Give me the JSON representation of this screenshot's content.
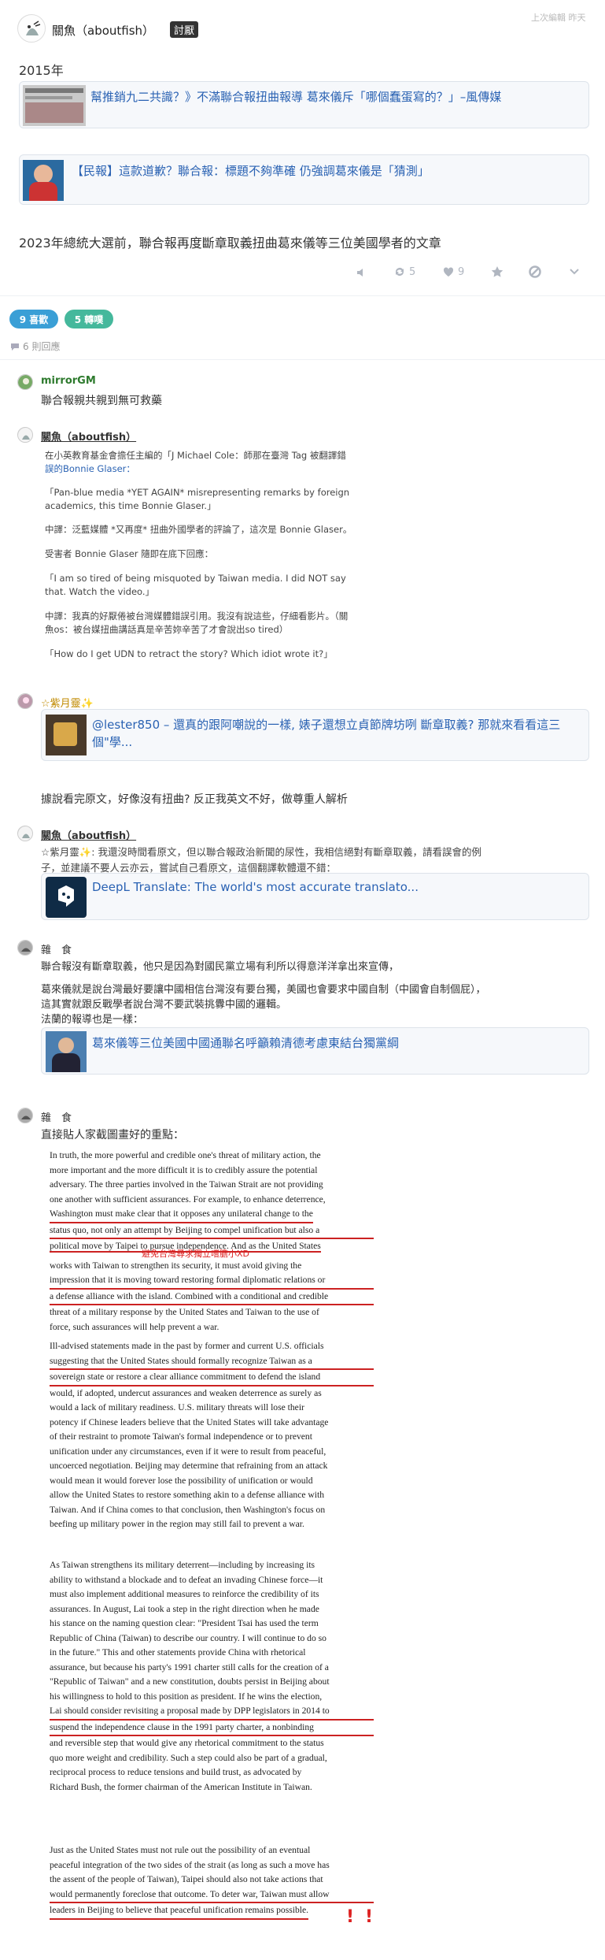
{
  "author": {
    "name": "關魚（aboutfish）",
    "badge": "討厭"
  },
  "edited": "上次編輯 昨天",
  "post": {
    "year": "2015年",
    "link1": "幫推銷九二共識？》不滿聯合報扭曲報導 葛來儀斥「哪個蠢蛋寫的？」–風傳媒",
    "link2": "【民報】這款道歉？聯合報：標題不夠準確 仍強調葛來儀是「猜測」",
    "text": "2023年總統大選前，聯合報再度斷章取義扭曲葛來儀等三位美國學者的文章",
    "actions": {
      "repost_count": "5",
      "like_count": "9"
    }
  },
  "tabs": {
    "likes": "9 喜歡",
    "reposts": "5 轉噗"
  },
  "replies_count": "6 則回應",
  "replies": [
    {
      "name": "mirrorGM",
      "text": "聯合報親共親到無可救藥"
    },
    {
      "name": "關魚（aboutfish）",
      "lines": [
        "在小英教育基金會擔任主編的「J Michael Cole：師那在臺灣 Tag 被翻譯錯",
        "誤的Bonnie Glaser：",
        "「Pan-blue media *YET AGAIN* misrepresenting remarks by foreign",
        "academics, this time Bonnie Glaser.」",
        "中譯：泛藍媒體 *又再度* 扭曲外國學者的評論了，這次是 Bonnie Glaser。",
        "受害者 Bonnie Glaser 隨即在底下回應：",
        "「I am so tired of being misquoted by Taiwan media. I did NOT say",
        "that. Watch the video.」",
        "中譯：我真的好厭倦被台灣媒體錯誤引用。我沒有說這些，仔細看影片。（關",
        "魚os：被台媒扭曲講話真是辛苦妳辛苦了才會說出so tired）",
        "「How do I get UDN to retract the story? Which idiot wrote it?」"
      ]
    },
    {
      "name": "☆紫月靈✨",
      "link": "@lester850 – 還真的跟阿嘲說的一樣, 婊子還想立貞節牌坊咧 斷章取義? 那就來看看這三個\"學...",
      "text": "據說看完原文，好像沒有扭曲? 反正我英文不好，做尊重人解析"
    },
    {
      "name": "關魚（aboutfish）",
      "line1": "☆紫月靈✨: 我還沒時間看原文，但以聯合報政治新聞的尿性，我相信絕對有斷章取義，請看誤會的例",
      "line2": "子，並建議不要人云亦云，嘗試自己看原文，這個翻譯軟體還不錯：",
      "link": "DeepL Translate: The world's most accurate translato..."
    },
    {
      "name": "雜　食",
      "lines": [
        "聯合報沒有斷章取義，他只是因為對國民黨立場有利所以得意洋洋拿出來宣傳，",
        "葛來儀就是說台灣最好要讓中國相信台灣沒有要台獨，美國也會要求中國自制（中國會自制個屁），",
        "這其實就跟反戰學者說台灣不要武裝挑釁中國的邏輯。",
        "法蘭的報導也是一樣："
      ],
      "link": "葛來儀等三位美國中國通聯名呼籲賴清德考慮東結台獨黨綱"
    },
    {
      "name": "雜　食",
      "text": "直接貼人家截圖畫好的重點："
    }
  ],
  "paper": {
    "handwritten_note": "避免台灣尋求獨立嚐膽小XD",
    "p1": [
      "In truth, the more powerful and credible one's threat of military action, the",
      "more important and the more difficult it is to credibly assure the potential",
      "adversary. The three parties involved in the Taiwan Strait are not providing",
      "one another with sufficient assurances. For example, to enhance deterrence,",
      "Washington must make clear that it opposes any unilateral change to the",
      "status quo, not only an attempt by Beijing to compel unification but also a",
      "political move by Taipei to pursue independence. And as the United States",
      "works with Taiwan to strengthen its security, it must avoid giving the",
      "impression that it is moving toward restoring formal diplomatic relations or",
      "a defense alliance with the island. Combined with a conditional and credible",
      "threat of a military response by the United States and Taiwan to the use of",
      "force, such assurances will help prevent a war."
    ],
    "p2": [
      "Ill-advised statements made in the past by former and current U.S. officials",
      "suggesting that the United States should formally recognize Taiwan as a",
      "sovereign state or restore a clear alliance commitment to defend the island",
      "would, if adopted, undercut assurances and weaken deterrence as surely as",
      "would a lack of military readiness. U.S. military threats will lose their",
      "potency if Chinese leaders believe that the United States will take advantage",
      "of their restraint to promote Taiwan's formal independence or to prevent",
      "unification under any circumstances, even if it were to result from peaceful,",
      "uncoerced negotiation. Beijing may determine that refraining from an attack",
      "would mean it would forever lose the possibility of unification or would",
      "allow the United States to restore something akin to a defense alliance with",
      "Taiwan. And if China comes to that conclusion, then Washington's focus on",
      "beefing up military power in the region may still fail to prevent a war."
    ],
    "p3": [
      "As Taiwan strengthens its military deterrent—including by increasing its",
      "ability to withstand a blockade and to defeat an invading Chinese force—it",
      "must also implement additional measures to reinforce the credibility of its",
      "assurances. In August, Lai took a step in the right direction when he made",
      "his stance on the naming question clear: \"President Tsai has used the term",
      "Republic of China (Taiwan) to describe our country. I will continue to do so",
      "in the future.\" This and other statements provide China with rhetorical",
      "assurance, but because his party's 1991 charter still calls for the creation of a",
      "\"Republic of Taiwan\" and a new constitution, doubts persist in Beijing about",
      "his willingness to hold to this position as president. If he wins the election,",
      "Lai should consider revisiting a proposal made by DPP legislators in 2014 to",
      "suspend the independence clause in the 1991 party charter, a nonbinding",
      "and reversible step that would give any rhetorical commitment to the status",
      "quo more weight and credibility. Such a step could also be part of a gradual,",
      "reciprocal process to reduce tensions and build trust, as advocated by",
      "Richard Bush, the former chairman of the American Institute in Taiwan."
    ],
    "p4": [
      "Just as the United States must not rule out the possibility of an eventual",
      "peaceful integration of the two sides of the strait (as long as such a move has",
      "the assent of the people of Taiwan), Taipei should also not take actions that",
      "would permanently foreclose that outcome. To deter war, Taiwan must allow",
      "leaders in Beijing to believe that peaceful unification remains possible."
    ]
  }
}
